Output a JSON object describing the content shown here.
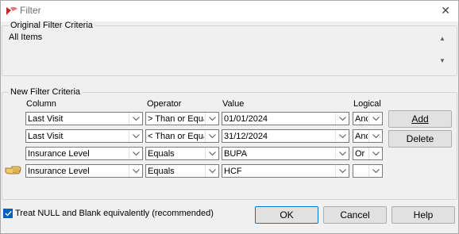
{
  "window": {
    "title": "Filter"
  },
  "original": {
    "legend": "Original Filter Criteria",
    "text": "All Items"
  },
  "newcrit": {
    "legend": "New Filter Criteria",
    "headers": {
      "column": "Column",
      "operator": "Operator",
      "value": "Value",
      "logical": "Logical"
    },
    "rows": [
      {
        "column": "Last Visit",
        "operator": "> Than or Equal",
        "value": "01/01/2024",
        "logical": "And"
      },
      {
        "column": "Last Visit",
        "operator": "< Than or Equal",
        "value": "31/12/2024",
        "logical": "And"
      },
      {
        "column": "Insurance Level",
        "operator": "Equals",
        "value": "BUPA",
        "logical": "Or"
      },
      {
        "column": "Insurance Level",
        "operator": "Equals",
        "value": "HCF",
        "logical": ""
      }
    ]
  },
  "buttons": {
    "add": "Add",
    "delete": "Delete",
    "ok": "OK",
    "cancel": "Cancel",
    "help": "Help"
  },
  "options": {
    "treat_null_label": "Treat NULL and Blank equivalently (recommended)",
    "treat_null_checked": true
  },
  "colors": {
    "accent": "#0078d7",
    "checkbox": "#0060c0",
    "icon_red": "#c4262e"
  },
  "icons": {
    "app": "filter-app-icon",
    "close": "close-icon",
    "row_pointer": "hand-pointer-icon",
    "dropdown": "chevron-down-icon"
  }
}
